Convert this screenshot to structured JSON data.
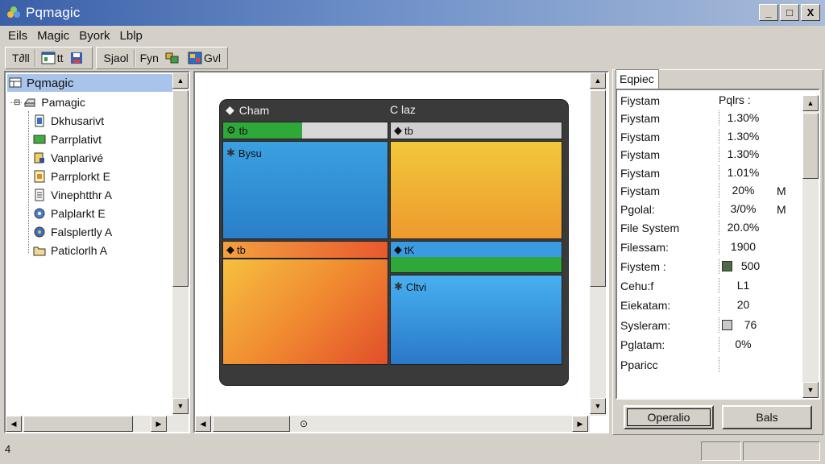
{
  "window": {
    "title": "Pqmagic",
    "controls": [
      "_",
      "□",
      "X"
    ]
  },
  "menu": [
    "Eils",
    "Magic",
    "Byork",
    "Lblp"
  ],
  "toolbar": {
    "btn1": "T∂ll",
    "btn2": "tt",
    "btn4": "Sjaol",
    "btn5": "Fyn",
    "btn6": "Gvl"
  },
  "tree": {
    "root": "Pqmagic",
    "parent": "Pamagic",
    "children": [
      "Dkhusarivt",
      "Parrplativt",
      "Vanplarivé",
      "Parrplorkt E",
      "Vinephtthr A",
      "Palplarkt E",
      "Falsplertly A",
      "Paticlorlh A"
    ]
  },
  "canvas": {
    "left_title": "Cham",
    "right_title": "C laz",
    "tile_a_label": "tb",
    "tile_b_label": "Bysu",
    "tile_c_label": "tb",
    "tile_d_label": "tb",
    "tile_e_label": "tK",
    "tile_f_label": "Cltvi",
    "colors": {
      "green": "#2fa83a",
      "blue": "#2f8fd6",
      "yellow": "#f0c53a",
      "orange": "#ef7a2c",
      "red": "#e0462a",
      "frame": "#3a3a3a"
    }
  },
  "properties": {
    "tab": "Eqpiec",
    "header": {
      "name": "Fiystam",
      "value": "Pqlrs :"
    },
    "rows": [
      {
        "name": "Fiystam",
        "value": "1.30%",
        "unit": ""
      },
      {
        "name": "Fiystam",
        "value": "1.30%",
        "unit": ""
      },
      {
        "name": "Fiystam",
        "value": "1.30%",
        "unit": ""
      },
      {
        "name": "Fiystam",
        "value": "1.01%",
        "unit": ""
      },
      {
        "name": "Fiystam",
        "value": "20%",
        "unit": "M"
      },
      {
        "name": "Pgolal:",
        "value": "3/0%",
        "unit": "M"
      },
      {
        "name": "File System",
        "value": "20.0%",
        "unit": ""
      },
      {
        "name": "Filessam:",
        "value": "1900",
        "unit": ""
      },
      {
        "name": "Fiystem :",
        "value": "500",
        "unit": "",
        "chip": "#4d6b45"
      },
      {
        "name": "Cehu:f",
        "value": "L1",
        "unit": ""
      },
      {
        "name": "Eiekatam:",
        "value": "20",
        "unit": ""
      },
      {
        "name": "Sysleram:",
        "value": "76",
        "unit": "",
        "chip": "#c8c8c8"
      },
      {
        "name": "Pglatam:",
        "value": "0%",
        "unit": ""
      },
      {
        "name": "Pparicc",
        "value": "",
        "unit": ""
      }
    ],
    "ok_button": "Operalio",
    "cancel_button": "Bals"
  },
  "status": {
    "text": "4"
  }
}
